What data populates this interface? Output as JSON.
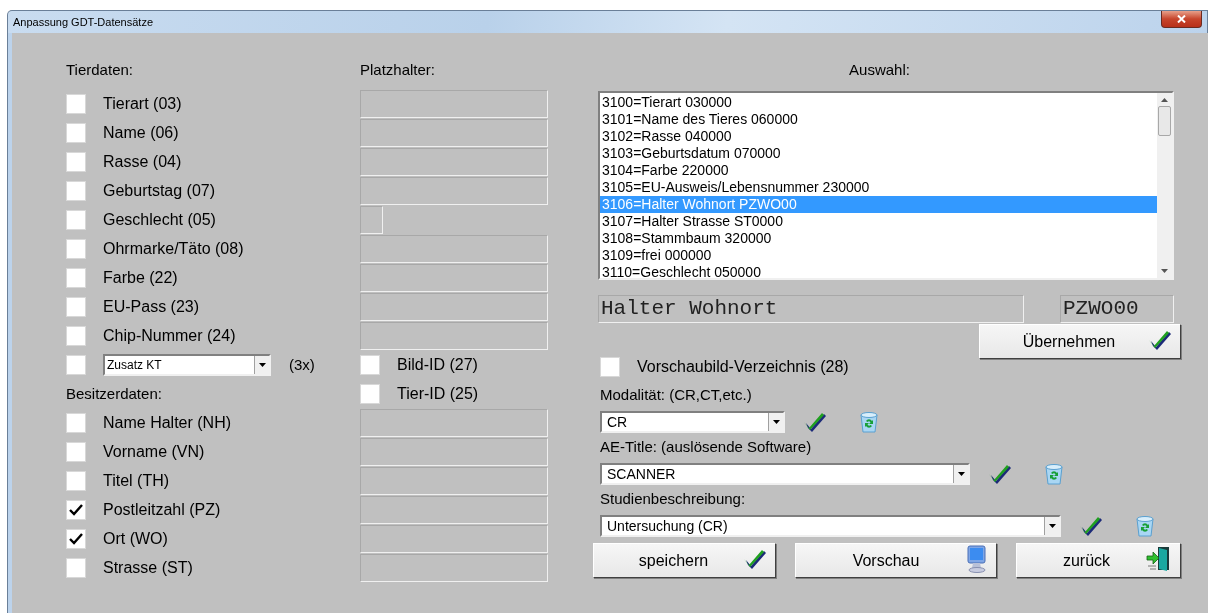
{
  "window": {
    "title": "Anpassung GDT-Datensätze"
  },
  "tierdaten": {
    "heading": "Tierdaten:",
    "items": [
      {
        "label": "Tierart (03)",
        "checked": false
      },
      {
        "label": "Name (06)",
        "checked": false
      },
      {
        "label": "Rasse (04)",
        "checked": false
      },
      {
        "label": "Geburtstag (07)",
        "checked": false
      },
      {
        "label": "Geschlecht (05)",
        "checked": false
      },
      {
        "label": "Ohrmarke/Täto (08)",
        "checked": false
      },
      {
        "label": "Farbe (22)",
        "checked": false
      },
      {
        "label": "EU-Pass (23)",
        "checked": false
      },
      {
        "label": "Chip-Nummer (24)",
        "checked": false
      }
    ]
  },
  "zusatz": {
    "checked": false,
    "value": "Zusatz KT",
    "suffix": "(3x)"
  },
  "besitzerdaten": {
    "heading": "Besitzerdaten:",
    "items": [
      {
        "label": "Name Halter (NH)",
        "checked": false
      },
      {
        "label": "Vorname (VN)",
        "checked": false
      },
      {
        "label": "Titel (TH)",
        "checked": false
      },
      {
        "label": "Postleitzahl (PZ)",
        "checked": true
      },
      {
        "label": "Ort (WO)",
        "checked": true
      },
      {
        "label": "Strasse (ST)",
        "checked": false
      }
    ]
  },
  "platzhalter": {
    "heading": "Platzhalter:",
    "tier_fields": [
      {
        "kind": "wide"
      },
      {
        "kind": "wide"
      },
      {
        "kind": "wide"
      },
      {
        "kind": "wide"
      },
      {
        "kind": "narrow"
      },
      {
        "kind": "wide"
      },
      {
        "kind": "wide"
      },
      {
        "kind": "wide"
      },
      {
        "kind": "wide"
      }
    ],
    "extra_checks": [
      {
        "label": "Bild-ID (27)",
        "checked": false
      },
      {
        "label": "Tier-ID (25)",
        "checked": false
      }
    ],
    "besitzer_fields": [
      {
        "kind": "wide"
      },
      {
        "kind": "wide"
      },
      {
        "kind": "wide"
      },
      {
        "kind": "wide"
      },
      {
        "kind": "wide"
      },
      {
        "kind": "wide"
      }
    ]
  },
  "auswahl": {
    "heading": "Auswahl:",
    "items": [
      {
        "text": "3100=Tierart 030000",
        "selected": false
      },
      {
        "text": "3101=Name des Tieres 060000",
        "selected": false
      },
      {
        "text": "3102=Rasse 040000",
        "selected": false
      },
      {
        "text": "3103=Geburtsdatum 070000",
        "selected": false
      },
      {
        "text": "3104=Farbe 220000",
        "selected": false
      },
      {
        "text": "3105=EU-Ausweis/Lebensnummer 230000",
        "selected": false
      },
      {
        "text": "3106=Halter Wohnort PZWO00",
        "selected": true
      },
      {
        "text": "3107=Halter Strasse ST0000",
        "selected": false
      },
      {
        "text": "3108=Stammbaum 320000",
        "selected": false
      },
      {
        "text": "3109=frei 000000",
        "selected": false
      },
      {
        "text": "3110=Geschlecht 050000",
        "selected": false
      }
    ]
  },
  "detail": {
    "name": "Halter Wohnort",
    "code": "PZWO00"
  },
  "uebernehmen_button": "Übernehmen",
  "vorschaubild": {
    "label": "Vorschaubild-Verzeichnis (28)",
    "checked": false
  },
  "combos": [
    {
      "label": "Modalität: (CR,CT,etc.)",
      "value": "CR",
      "kind": "short"
    },
    {
      "label": "AE-Title: (auslösende Software)",
      "value": "SCANNER",
      "kind": "medium"
    },
    {
      "label": "Studienbeschreibung:",
      "value": "Untersuchung (CR)",
      "kind": "long"
    }
  ],
  "buttons": [
    {
      "label": "speichern",
      "kind": "check"
    },
    {
      "label": "Vorschau",
      "kind": "monitor"
    },
    {
      "label": "zurück",
      "kind": "exit"
    }
  ]
}
